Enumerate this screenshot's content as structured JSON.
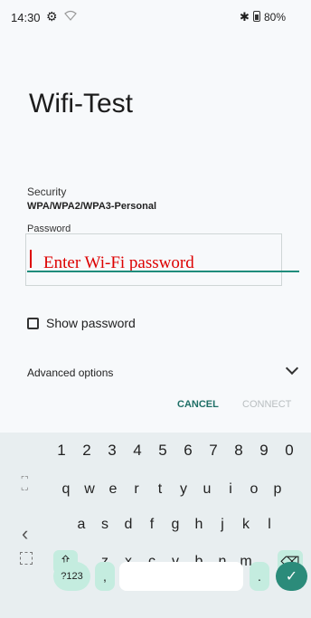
{
  "status_bar": {
    "time": "14:30",
    "battery": "80%"
  },
  "dialog": {
    "title": "Wifi-Test",
    "security_label": "Security",
    "security_value": "WPA/WPA2/WPA3-Personal",
    "password_label": "Password",
    "password_placeholder": "Enter Wi-Fi password",
    "show_password_label": "Show password",
    "advanced_options_label": "Advanced options",
    "cancel_label": "CANCEL",
    "connect_label": "CONNECT"
  },
  "keyboard": {
    "number_row": [
      "1",
      "2",
      "3",
      "4",
      "5",
      "6",
      "7",
      "8",
      "9",
      "0"
    ],
    "row1": [
      "q",
      "w",
      "e",
      "r",
      "t",
      "y",
      "u",
      "i",
      "o",
      "p"
    ],
    "row2": [
      "a",
      "s",
      "d",
      "f",
      "g",
      "h",
      "j",
      "k",
      "l"
    ],
    "row3": [
      "z",
      "x",
      "c",
      "v",
      "b",
      "n",
      "m"
    ],
    "symbols_label": "?123",
    "comma": ",",
    "period": "."
  },
  "colors": {
    "accent": "#1f8c7c",
    "key_highlight": "#c4ecdf",
    "overlay_text": "#dd0000"
  }
}
